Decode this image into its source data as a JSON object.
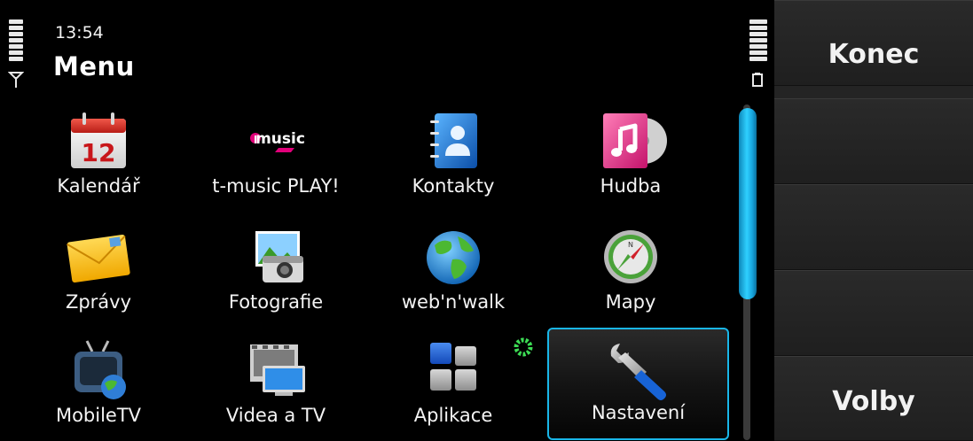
{
  "status": {
    "time": "13:54",
    "signal_bars": 7,
    "battery_bars": 7
  },
  "header": {
    "title": "Menu"
  },
  "apps": [
    {
      "label": "Kalendář",
      "icon": "calendar-icon",
      "day": "12"
    },
    {
      "label": "t-music PLAY!",
      "icon": "tmusic-icon",
      "logo_text": "music"
    },
    {
      "label": "Kontakty",
      "icon": "contacts-icon"
    },
    {
      "label": "Hudba",
      "icon": "music-icon"
    },
    {
      "label": "Zprávy",
      "icon": "envelope-icon"
    },
    {
      "label": "Fotografie",
      "icon": "photos-icon"
    },
    {
      "label": "web'n'walk",
      "icon": "globe-icon"
    },
    {
      "label": "Mapy",
      "icon": "compass-icon"
    },
    {
      "label": "MobileTV",
      "icon": "tv-icon"
    },
    {
      "label": "Videa a TV",
      "icon": "video-icon"
    },
    {
      "label": "Aplikace",
      "icon": "apps-folder-icon"
    },
    {
      "label": "Nastavení",
      "icon": "wrench-icon",
      "selected": true
    }
  ],
  "softkeys": {
    "top": "Konec",
    "bottom": "Volby"
  },
  "colors": {
    "highlight": "#19b6e8",
    "scroll_thumb": "#2fd0ff",
    "softkey_bg": "#242424"
  }
}
